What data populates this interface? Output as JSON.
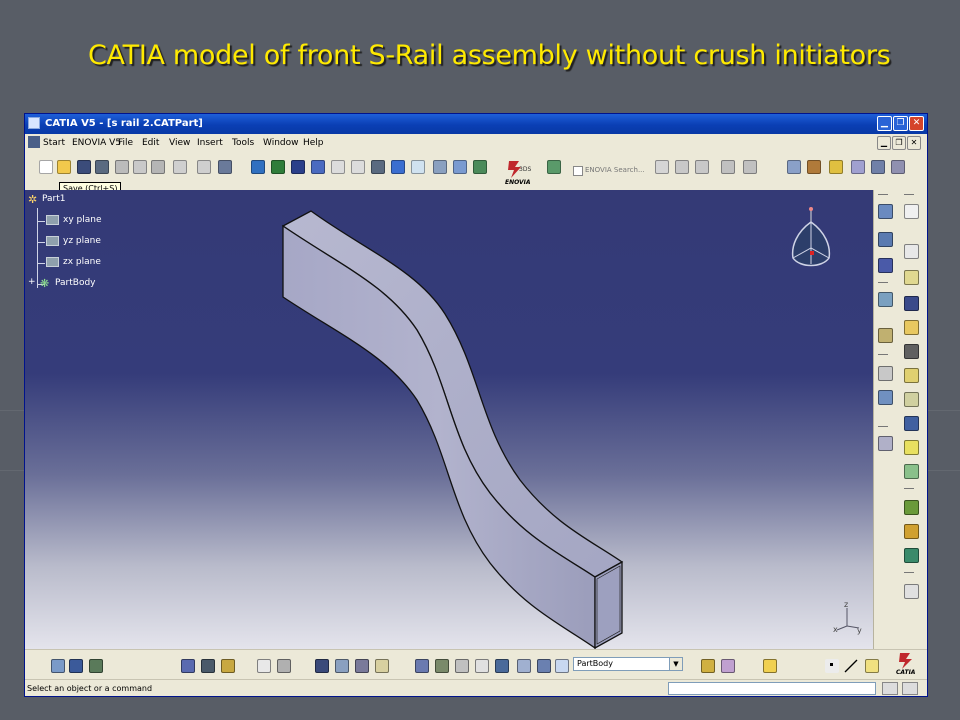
{
  "slide": {
    "title": "CATIA model of front S-Rail assembly without crush initiators"
  },
  "window": {
    "title": "CATIA V5 - [s rail 2.CATPart]",
    "controls": [
      "minimize-icon",
      "restore-icon",
      "close-icon"
    ]
  },
  "menubar": {
    "items": [
      {
        "label": "Start"
      },
      {
        "label": "ENOVIA V5"
      },
      {
        "label": "File"
      },
      {
        "label": "Edit"
      },
      {
        "label": "View"
      },
      {
        "label": "Insert"
      },
      {
        "label": "Tools"
      },
      {
        "label": "Window"
      },
      {
        "label": "Help"
      }
    ],
    "doc_controls": [
      "minimize-icon",
      "restore-icon",
      "close-icon"
    ]
  },
  "toolbar": {
    "tooltip": "Save (Ctrl+S)",
    "enovia_logo_text": "ENOVIA",
    "enovia_search_label": "ENOVIA Search..."
  },
  "tree": {
    "root": "Part1",
    "children": [
      {
        "label": "xy plane",
        "icon": "plane-icon"
      },
      {
        "label": "yz plane",
        "icon": "plane-icon"
      },
      {
        "label": "zx plane",
        "icon": "plane-icon"
      },
      {
        "label": "PartBody",
        "icon": "partbody-icon"
      }
    ]
  },
  "axis_labels": {
    "z": "z",
    "x": "x",
    "y": "y"
  },
  "bottom_toolbar": {
    "current_body": "PartBody"
  },
  "catia_logo_text": "CATIA",
  "status": {
    "message": "Select an object or a command",
    "command_input_value": ""
  },
  "colors": {
    "title_yellow": "#ffea00",
    "slide_bg": "#585d66",
    "viewport_top": "#343a76",
    "rail_face": "#a9aac8",
    "titlebar_blue": "#0a3fb4"
  }
}
